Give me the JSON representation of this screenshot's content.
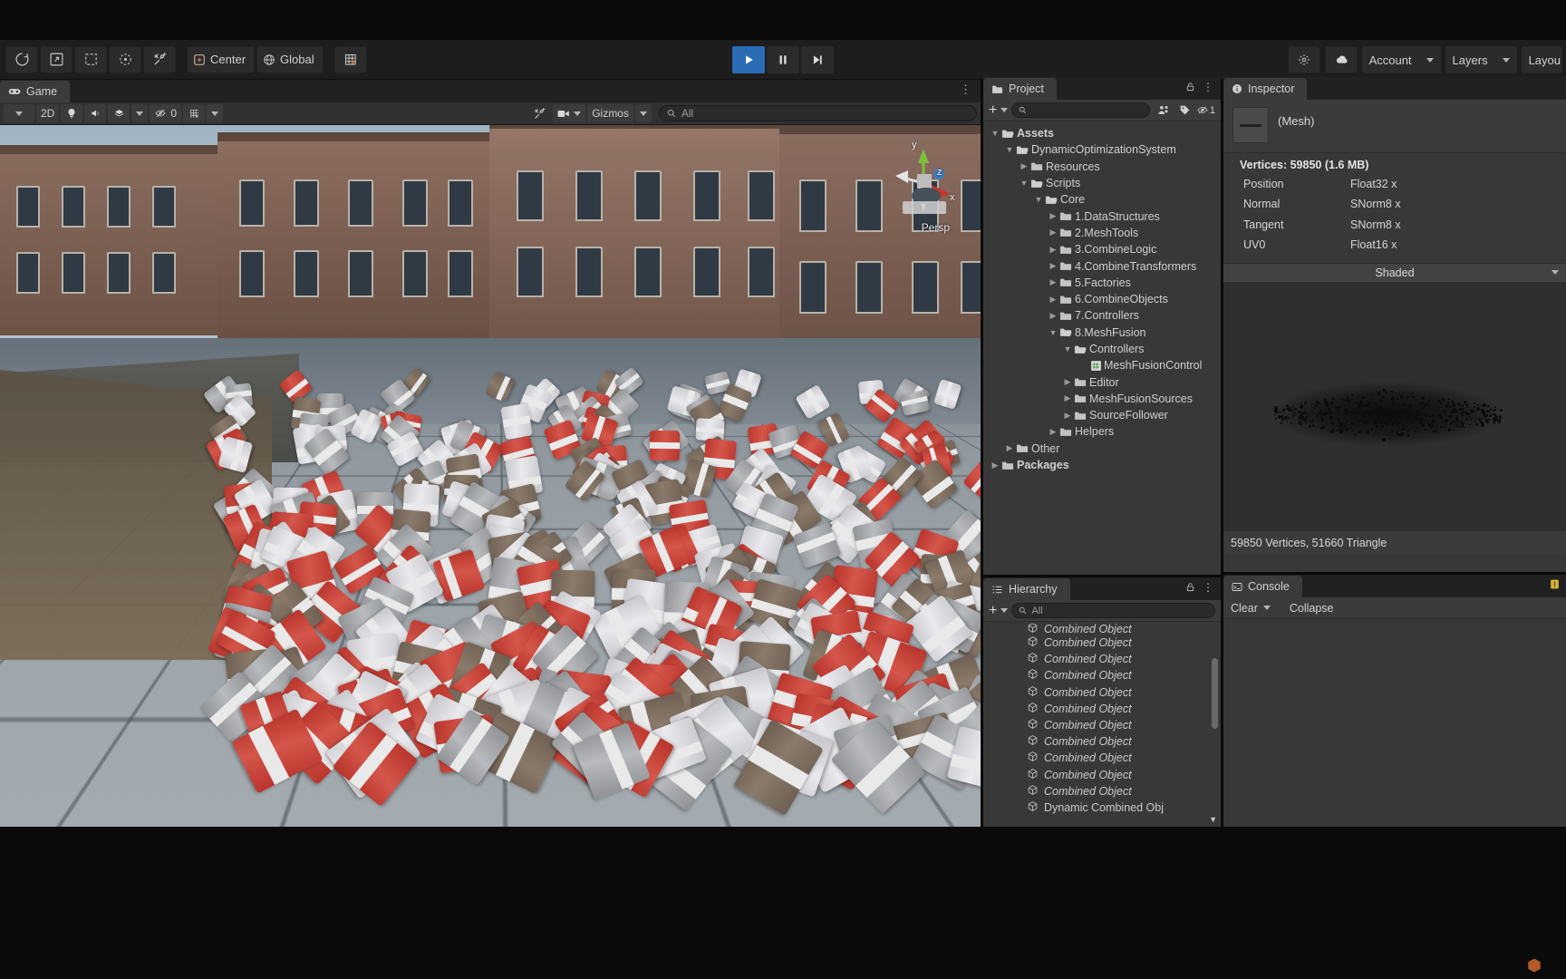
{
  "toolbar": {
    "tools": [
      {
        "name": "hand-tool",
        "icon": "hand"
      },
      {
        "name": "move-tool",
        "icon": "move"
      },
      {
        "name": "rect-tool",
        "icon": "rect"
      },
      {
        "name": "scale-tool",
        "icon": "scale"
      },
      {
        "name": "custom-tool",
        "icon": "wrench"
      }
    ],
    "pivot_label": "Center",
    "handle_label": "Global",
    "grid_label": "",
    "play_label": "▶",
    "pause_label": "❘❘",
    "step_label": "▶❘",
    "account_label": "Account",
    "layers_label": "Layers",
    "layout_label": "Layou"
  },
  "game_view": {
    "tab_label": "Game",
    "mode_label": "2D",
    "stats_count": "0",
    "gizmos_label": "Gizmos",
    "search_placeholder": "All",
    "gizmo_axes": [
      "y",
      "z",
      "x"
    ],
    "persp_label": "Persp"
  },
  "project": {
    "tab_label": "Project",
    "search_placeholder": "",
    "badge_count": "1",
    "tree": [
      {
        "label": "Assets",
        "depth": 0,
        "state": "open",
        "kind": "folder"
      },
      {
        "label": "DynamicOptimizationSystem",
        "depth": 1,
        "state": "open",
        "kind": "folder"
      },
      {
        "label": "Resources",
        "depth": 2,
        "state": "closed",
        "kind": "folder"
      },
      {
        "label": "Scripts",
        "depth": 2,
        "state": "open",
        "kind": "folder"
      },
      {
        "label": "Core",
        "depth": 3,
        "state": "open",
        "kind": "folder"
      },
      {
        "label": "1.DataStructures",
        "depth": 4,
        "state": "closed",
        "kind": "folder"
      },
      {
        "label": "2.MeshTools",
        "depth": 4,
        "state": "closed",
        "kind": "folder"
      },
      {
        "label": "3.CombineLogic",
        "depth": 4,
        "state": "closed",
        "kind": "folder"
      },
      {
        "label": "4.CombineTransformers",
        "depth": 4,
        "state": "closed",
        "kind": "folder"
      },
      {
        "label": "5.Factories",
        "depth": 4,
        "state": "closed",
        "kind": "folder"
      },
      {
        "label": "6.CombineObjects",
        "depth": 4,
        "state": "closed",
        "kind": "folder"
      },
      {
        "label": "7.Controllers",
        "depth": 4,
        "state": "closed",
        "kind": "folder"
      },
      {
        "label": "8.MeshFusion",
        "depth": 4,
        "state": "open",
        "kind": "folder"
      },
      {
        "label": "Controllers",
        "depth": 5,
        "state": "open",
        "kind": "folder"
      },
      {
        "label": "MeshFusionControl",
        "depth": 6,
        "state": "none",
        "kind": "script"
      },
      {
        "label": "Editor",
        "depth": 5,
        "state": "closed",
        "kind": "folder"
      },
      {
        "label": "MeshFusionSources",
        "depth": 5,
        "state": "closed",
        "kind": "folder"
      },
      {
        "label": "SourceFollower",
        "depth": 5,
        "state": "closed",
        "kind": "folder"
      },
      {
        "label": "Helpers",
        "depth": 4,
        "state": "closed",
        "kind": "folder"
      },
      {
        "label": "Other",
        "depth": 1,
        "state": "closed",
        "kind": "folder"
      },
      {
        "label": "Packages",
        "depth": 0,
        "state": "closed",
        "kind": "folder"
      }
    ]
  },
  "hierarchy": {
    "tab_label": "Hierarchy",
    "search_placeholder": "All",
    "items": [
      {
        "label": "Combined Object",
        "style": "italic"
      },
      {
        "label": "Combined Object",
        "style": "italic"
      },
      {
        "label": "Combined Object",
        "style": "italic"
      },
      {
        "label": "Combined Object",
        "style": "italic"
      },
      {
        "label": "Combined Object",
        "style": "italic"
      },
      {
        "label": "Combined Object",
        "style": "italic"
      },
      {
        "label": "Combined Object",
        "style": "italic"
      },
      {
        "label": "Combined Object",
        "style": "italic"
      },
      {
        "label": "Combined Object",
        "style": "italic"
      },
      {
        "label": "Combined Object",
        "style": "italic"
      },
      {
        "label": "Combined Object",
        "style": "italic"
      },
      {
        "label": "Dynamic Combined Obj",
        "style": "normal"
      }
    ]
  },
  "inspector": {
    "tab_label": "Inspector",
    "object_label": "(Mesh)",
    "vertices_header": "Vertices: 59850 (1.6 MB)",
    "attributes": [
      {
        "name": "Position",
        "format": "Float32 x"
      },
      {
        "name": "Normal",
        "format": "SNorm8 x"
      },
      {
        "name": "Tangent",
        "format": "SNorm8 x"
      },
      {
        "name": "UV0",
        "format": "Float16 x"
      }
    ],
    "shading_mode": "Shaded",
    "preview_stats": "59850 Vertices, 51660 Triangle"
  },
  "console": {
    "tab_label": "Console",
    "clear_label": "Clear",
    "collapse_label": "Collapse"
  }
}
